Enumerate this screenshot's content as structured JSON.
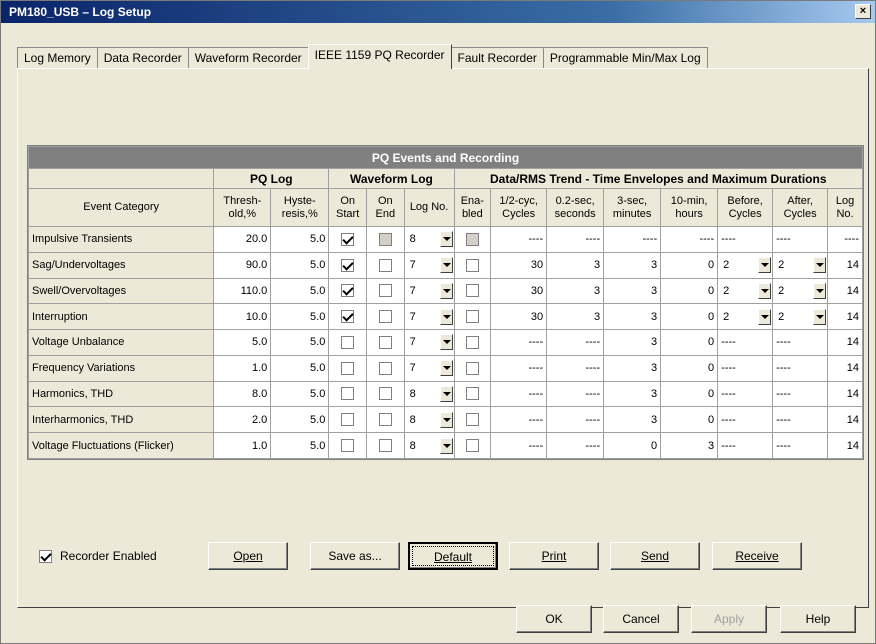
{
  "window": {
    "title": "PM180_USB – Log Setup",
    "close_label": "×"
  },
  "tabs": [
    {
      "label": "Log Memory"
    },
    {
      "label": "Data Recorder"
    },
    {
      "label": "Waveform Recorder"
    },
    {
      "label": "IEEE 1159 PQ Recorder"
    },
    {
      "label": "Fault Recorder"
    },
    {
      "label": "Programmable Min/Max Log"
    }
  ],
  "grid": {
    "title": "PQ Events and Recording",
    "groups": {
      "pq_log": "PQ Log",
      "waveform_log": "Waveform Log",
      "trend": "Data/RMS Trend - Time Envelopes and Maximum Durations"
    },
    "headers": [
      "Event Category",
      "Thresh-old,%",
      "Hyste-resis,%",
      "On Start",
      "On End",
      "Log No.",
      "Ena-bled",
      "1/2-cyc, Cycles",
      "0.2-sec, seconds",
      "3-sec, minutes",
      "10-min, hours",
      "Before, Cycles",
      "After, Cycles",
      "Log No."
    ],
    "rows": [
      {
        "category": "Impulsive Transients",
        "threshold": "20.0",
        "hysteresis": "5.0",
        "on_start": true,
        "on_end": false,
        "on_end_disabled": true,
        "log": "8",
        "enabled": false,
        "enabled_disabled": true,
        "half_cyc": "----",
        "sec02": "----",
        "sec3": "----",
        "min10": "----",
        "before": "----",
        "after": "----",
        "trend_log": "----"
      },
      {
        "category": "Sag/Undervoltages",
        "threshold": "90.0",
        "hysteresis": "5.0",
        "on_start": true,
        "on_end": false,
        "log": "7",
        "enabled": false,
        "half_cyc": "30",
        "sec02": "3",
        "sec3": "3",
        "min10": "0",
        "before": "2",
        "after": "2",
        "trend_log": "14"
      },
      {
        "category": "Swell/Overvoltages",
        "threshold": "110.0",
        "hysteresis": "5.0",
        "on_start": true,
        "on_end": false,
        "log": "7",
        "enabled": false,
        "half_cyc": "30",
        "sec02": "3",
        "sec3": "3",
        "min10": "0",
        "before": "2",
        "after": "2",
        "trend_log": "14"
      },
      {
        "category": "Interruption",
        "threshold": "10.0",
        "hysteresis": "5.0",
        "on_start": true,
        "on_end": false,
        "log": "7",
        "enabled": false,
        "half_cyc": "30",
        "sec02": "3",
        "sec3": "3",
        "min10": "0",
        "before": "2",
        "after": "2",
        "trend_log": "14"
      },
      {
        "category": "Voltage Unbalance",
        "threshold": "5.0",
        "hysteresis": "5.0",
        "on_start": false,
        "on_end": false,
        "log": "7",
        "enabled": false,
        "half_cyc": "----",
        "sec02": "----",
        "sec3": "3",
        "min10": "0",
        "before": "----",
        "after": "----",
        "trend_log": "14"
      },
      {
        "category": "Frequency Variations",
        "threshold": "1.0",
        "hysteresis": "5.0",
        "on_start": false,
        "on_end": false,
        "log": "7",
        "enabled": false,
        "half_cyc": "----",
        "sec02": "----",
        "sec3": "3",
        "min10": "0",
        "before": "----",
        "after": "----",
        "trend_log": "14"
      },
      {
        "category": "Harmonics, THD",
        "threshold": "8.0",
        "hysteresis": "5.0",
        "on_start": false,
        "on_end": false,
        "log": "8",
        "enabled": false,
        "half_cyc": "----",
        "sec02": "----",
        "sec3": "3",
        "min10": "0",
        "before": "----",
        "after": "----",
        "trend_log": "14"
      },
      {
        "category": "Interharmonics, THD",
        "threshold": "2.0",
        "hysteresis": "5.0",
        "on_start": false,
        "on_end": false,
        "log": "8",
        "enabled": false,
        "half_cyc": "----",
        "sec02": "----",
        "sec3": "3",
        "min10": "0",
        "before": "----",
        "after": "----",
        "trend_log": "14"
      },
      {
        "category": "Voltage Fluctuations (Flicker)",
        "threshold": "1.0",
        "hysteresis": "5.0",
        "on_start": false,
        "on_end": false,
        "log": "8",
        "enabled": false,
        "half_cyc": "----",
        "sec02": "----",
        "sec3": "0",
        "min10": "3",
        "before": "----",
        "after": "----",
        "trend_log": "14"
      }
    ]
  },
  "recorder_enabled": {
    "label": "Recorder Enabled",
    "checked": true
  },
  "buttons": {
    "open": {
      "label": "Open"
    },
    "save_as": {
      "label": "Save as..."
    },
    "default": {
      "label": "Default"
    },
    "print": {
      "label": "Print"
    },
    "send": {
      "label": "Send"
    },
    "receive": {
      "label": "Receive"
    },
    "ok": "OK",
    "cancel": "Cancel",
    "apply": "Apply",
    "help": "Help"
  }
}
